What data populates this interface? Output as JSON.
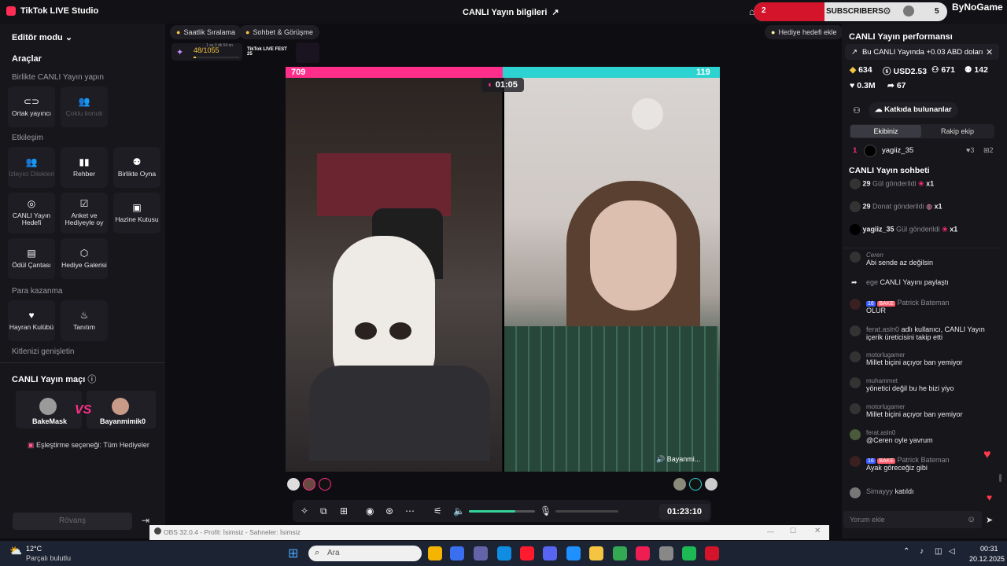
{
  "app": {
    "title": "TikTok LIVE Studio",
    "center_title": "CANLI Yayın bilgileri"
  },
  "subs": {
    "count_left": "2",
    "label": "SUBSCRIBERS",
    "count_right": "5",
    "brand": "ByNoGame"
  },
  "left": {
    "editor_mode": "Editör modu",
    "tools_heading": "Araçlar",
    "section_together": "Birlikte CANLI Yayın yapın",
    "tile_cohost": "Ortak yayıncı",
    "tile_multi": "Çoklu konuk",
    "section_interaction": "Etkileşim",
    "tile_requests": "İzleyici Dilekleri",
    "tile_guide": "Rehber",
    "tile_play": "Birlikte Oyna",
    "tile_goal": "CANLI Yayın Hedefi",
    "tile_poll": "Anket ve Hediyeyle oy",
    "tile_treasure": "Hazine Kutusu",
    "tile_reward": "Ödül Çantası",
    "tile_gallery": "Hediye Galerisi",
    "section_monetize": "Para kazanma",
    "tile_fanclub": "Hayran Kulübü",
    "tile_promote": "Tanıtım",
    "section_expand": "Kitlenizi genişletin",
    "match_heading": "CANLI Yayın maçı",
    "player1": "BakeMask",
    "vs": "VS",
    "player2": "Bayanmimik0",
    "match_option": "Eşleştirme seçeneği: Tüm Hediyeler",
    "rematch": "Rövanş"
  },
  "center": {
    "chip_hourly": "Saatlik Sıralama",
    "chip_chat": "Sohbet & Görüşme",
    "gift_goal": "Hediye hedefi ekle",
    "progress_text": "48/1055",
    "progress_sub": "1 sa 0 dk 54 sn",
    "fest": "TikTok LIVE FEST 25",
    "score_left": "709",
    "score_right": "119",
    "battle_timer": "01:05",
    "right_name": "Bayanmi...",
    "stream_time": "01:23:10",
    "volume_level": 0.7
  },
  "right": {
    "perf_heading": "CANLI Yayın performansı",
    "perf_banner": "Bu CANLI Yayında +0.03 ABD doları",
    "stat_diamonds": "634",
    "stat_usd": "USD2.53",
    "stat_viewers": "671",
    "stat_likes_top": "142",
    "stat_likes": "0.3M",
    "stat_shares": "67",
    "contributors": "Katkıda bulunanlar",
    "tab_us": "Ekibiniz",
    "tab_rival": "Rakip ekip",
    "rank1_num": "1",
    "rank1_name": "yagiiz_35",
    "rank1_hearts": "3",
    "rank1_gifts": "2",
    "chat_heading": "CANLI Yayın sohbeti",
    "gift1_count": "29",
    "gift1_text": "Gül gönderildi",
    "gift1_mult": "x1",
    "gift2_count": "29",
    "gift2_text": "Donat gönderildi",
    "gift2_mult": "x1",
    "gift3_user": "yagiiz_35",
    "gift3_text": "Gül gönderildi",
    "gift3_mult": "x1",
    "msgs": [
      {
        "user": "Ceren",
        "text": "Abi sende az değilsin"
      },
      {
        "user": "ege",
        "text": "CANLI Yayını paylaştı"
      },
      {
        "user": "Patrick Bateman",
        "badge": "16",
        "badge2": "BAKE",
        "text": "OLUR"
      },
      {
        "user": "ferat.asln0",
        "text": "adlı kullanıcı, CANLI Yayın içerik üreticisini takip etti"
      },
      {
        "user": "motorlugamer",
        "text": "Millet biçini açıyor ban yemiyor"
      },
      {
        "user": "muhammet",
        "text": "yönetici değil bu he bizi yiyo"
      },
      {
        "user": "motorlugamer",
        "text": "Millet biçini açıyor ban yemiyor"
      },
      {
        "user": "ferat.asln0",
        "text": "@Ceren oyle yavrum"
      },
      {
        "user": "Patrick Bateman",
        "badge": "16",
        "badge2": "BAKE",
        "text": "Ayak göreceğiz gibi"
      },
      {
        "user": "Simayyy",
        "text": "katıldı"
      }
    ],
    "comment_placeholder": "Yorum ekle"
  },
  "obs": {
    "text": "OBS 32.0.4 - Profil: İsimsiz - Sahneler: İsimsiz"
  },
  "taskbar": {
    "weather_temp": "12°C",
    "weather_desc": "Parçalı bulutlu",
    "search": "Ara",
    "time": "00:31",
    "date": "20.12.2025"
  }
}
